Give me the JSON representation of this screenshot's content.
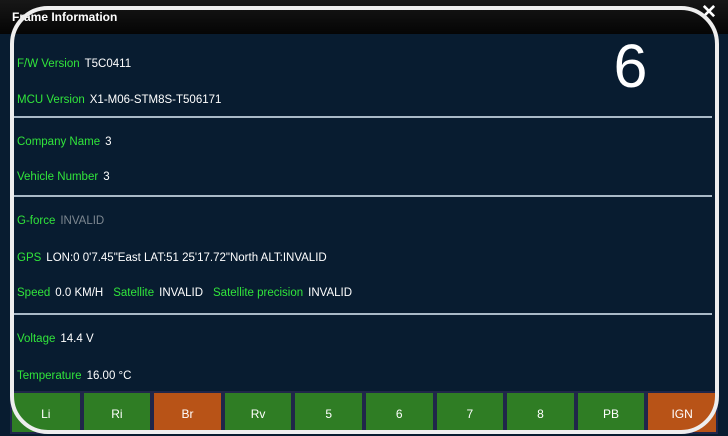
{
  "window": {
    "title": "Frame Information",
    "close_glyph": "✕",
    "overlay_number": "6"
  },
  "sections": {
    "firmware": {
      "fw_label": "F/W Version",
      "fw_value": "T5C0411",
      "mcu_label": "MCU Version",
      "mcu_value": "X1-M06-STM8S-T506171"
    },
    "company": {
      "company_label": "Company Name",
      "company_value": "3",
      "vehicle_label": "Vehicle Number",
      "vehicle_value": "3"
    },
    "sensors": {
      "gforce_label": "G-force",
      "gforce_value": "INVALID",
      "gps_label": "GPS",
      "gps_value": "LON:0 0'7.45\"East LAT:51 25'17.72\"North ALT:INVALID",
      "speed_label": "Speed",
      "speed_value": "0.0 KM/H",
      "satellite_label": "Satellite",
      "satellite_value": "INVALID",
      "precision_label": "Satellite precision",
      "precision_value": "INVALID"
    },
    "power": {
      "voltage_label": "Voltage",
      "voltage_value": "14.4 V",
      "temperature_label": "Temperature",
      "temperature_value": "16.00 °C"
    }
  },
  "buttons": [
    {
      "label": "Li",
      "color": "#2f7d24"
    },
    {
      "label": "Ri",
      "color": "#2f7d24"
    },
    {
      "label": "Br",
      "color": "#b85317"
    },
    {
      "label": "Rv",
      "color": "#2f7d24"
    },
    {
      "label": "5",
      "color": "#2f7d24"
    },
    {
      "label": "6",
      "color": "#2f7d24"
    },
    {
      "label": "7",
      "color": "#2f7d24"
    },
    {
      "label": "8",
      "color": "#2f7d24"
    },
    {
      "label": "PB",
      "color": "#2f7d24"
    },
    {
      "label": "IGN",
      "color": "#b85317"
    }
  ],
  "colors": {
    "background": "#081c30",
    "label_green": "#31e53b",
    "value_white": "#ffffff",
    "invalid_gray": "#7d8790",
    "active_orange": "#b85317",
    "inactive_green": "#2f7d24"
  }
}
